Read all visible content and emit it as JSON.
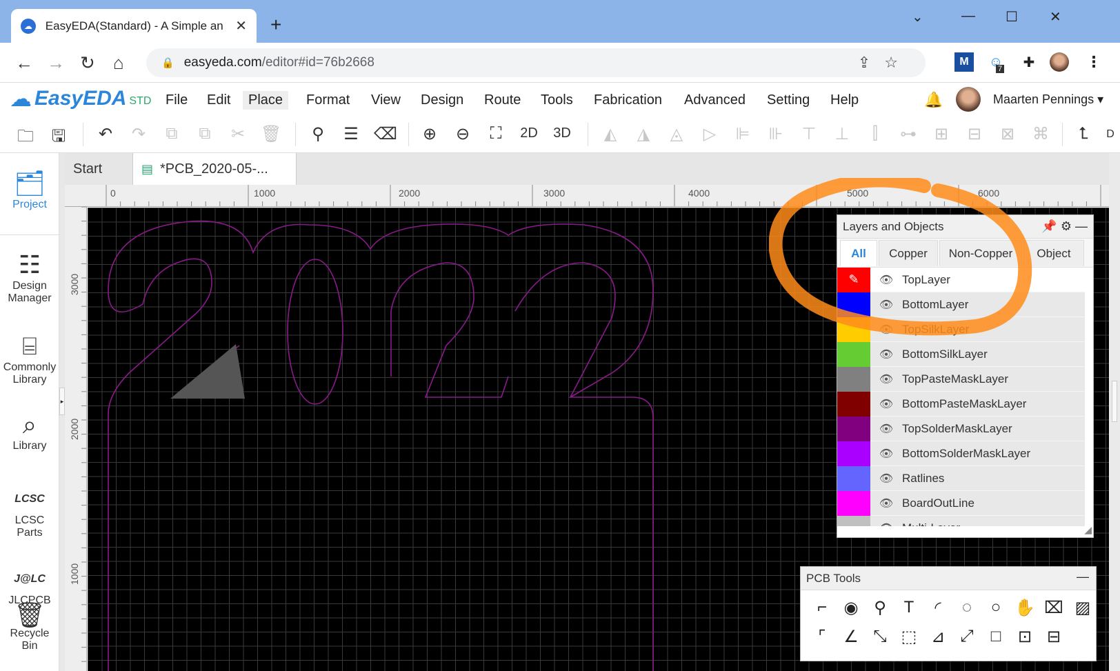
{
  "browser": {
    "tab_title": "EasyEDA(Standard) - A Simple an",
    "new_tab": "+",
    "url_host": "easyeda.com",
    "url_path": "/editor#id=76b2668",
    "ext_badge": "7",
    "ext_m": "M"
  },
  "app": {
    "logo_name": "EasyEDA",
    "logo_std": "STD",
    "menus": [
      "File",
      "Edit",
      "Place",
      "Format",
      "View",
      "Design",
      "Route",
      "Tools",
      "Fabrication",
      "Advanced",
      "Setting",
      "Help"
    ],
    "active_menu": "Place",
    "user": "Maarten Pennings ▾",
    "toolbar_2d": "2D",
    "toolbar_3d": "3D",
    "toolbar_more": "D"
  },
  "sidebar": {
    "items": [
      {
        "label": "Project",
        "icon": "folder-icon"
      },
      {
        "label": "Design\nManager",
        "icon": "list-icon"
      },
      {
        "label": "Commonly\nLibrary",
        "icon": "chip-icon"
      },
      {
        "label": "Library",
        "icon": "library-search-icon"
      },
      {
        "label": "LCSC\nParts",
        "icon": "lcsc-icon"
      },
      {
        "label": "JLCPCB",
        "icon": "jlc-icon"
      },
      {
        "label": "Recycle\nBin",
        "icon": "trash-icon"
      }
    ],
    "lcsc_logo": "LCSC",
    "jlc_logo": "J@LC"
  },
  "doc_tabs": {
    "start": "Start",
    "pcb": "*PCB_2020-05-..."
  },
  "rulers": {
    "top": [
      "0",
      "1000",
      "2000",
      "3000",
      "4000",
      "5000",
      "6000"
    ],
    "left": [
      "3000",
      "2000",
      "1000"
    ]
  },
  "layers_panel": {
    "title": "Layers and Objects",
    "tabs": [
      "All",
      "Copper",
      "Non-Copper",
      "Object"
    ],
    "active_tab": "All",
    "layers": [
      {
        "name": "TopLayer",
        "color": "#ff0000"
      },
      {
        "name": "BottomLayer",
        "color": "#0000ff"
      },
      {
        "name": "TopSilkLayer",
        "color": "#ffcc00"
      },
      {
        "name": "BottomSilkLayer",
        "color": "#66cc33"
      },
      {
        "name": "TopPasteMaskLayer",
        "color": "#808080"
      },
      {
        "name": "BottomPasteMaskLayer",
        "color": "#800000"
      },
      {
        "name": "TopSolderMaskLayer",
        "color": "#800080"
      },
      {
        "name": "BottomSolderMaskLayer",
        "color": "#aa00ff"
      },
      {
        "name": "Ratlines",
        "color": "#6464ff"
      },
      {
        "name": "BoardOutLine",
        "color": "#ff00ff"
      },
      {
        "name": "Multi-Layer",
        "color": "#c0c0c0"
      }
    ],
    "annotation_color": "#ff8c1a"
  },
  "pcb_tools": {
    "title": "PCB Tools",
    "tools": [
      "track-icon",
      "pad-icon",
      "via-icon",
      "text-icon",
      "arc-icon",
      "arc2-icon",
      "circle-icon",
      "pan-icon",
      "image-icon",
      "photo-icon",
      "line-icon",
      "angle-icon",
      "dimension-icon",
      "rect-dashed-icon",
      "solid-region-icon",
      "connect-icon",
      "rect-icon",
      "copper-area-icon",
      "layout-icon"
    ]
  },
  "board_outline_color": "#8b1a8b"
}
